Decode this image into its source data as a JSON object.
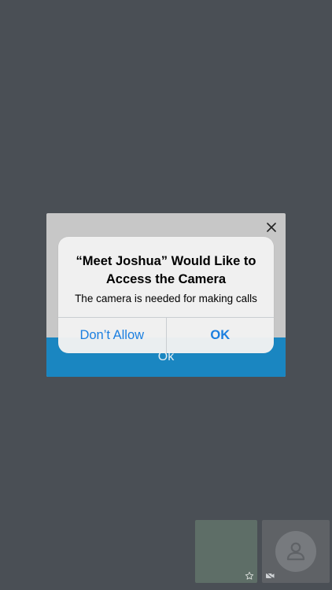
{
  "app_dialog": {
    "ok_label": "Ok",
    "close_icon": "close-icon"
  },
  "system_alert": {
    "title": "“Meet Joshua” Would Like to Access the Camera",
    "message": "The camera is needed for making calls",
    "deny_label": "Don’t Allow",
    "allow_label": "OK"
  },
  "video_tiles": {
    "self_icon": "star-icon",
    "remote_avatar_icon": "person-icon",
    "remote_status_icon": "camera-off-icon"
  },
  "colors": {
    "background": "#4a4f55",
    "app_button": "#1a86c1",
    "alert_button_text": "#1b7fe0"
  }
}
